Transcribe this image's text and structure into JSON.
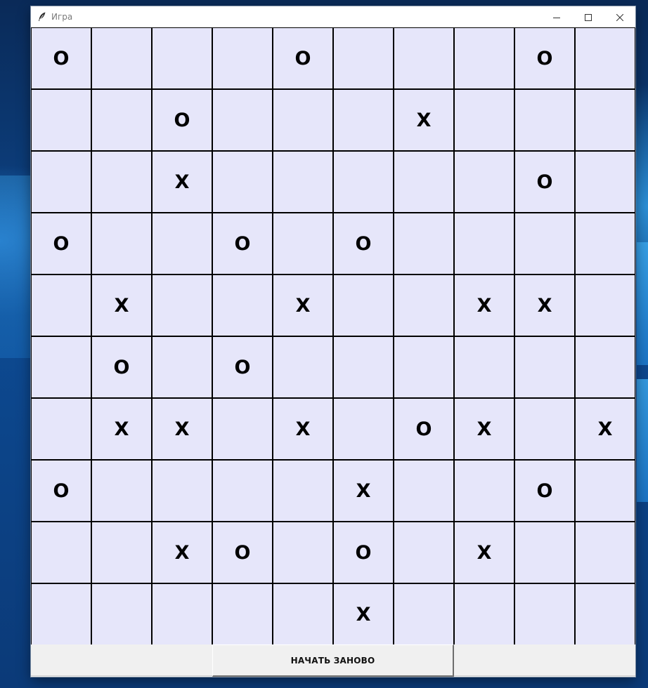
{
  "window": {
    "title": "Игра",
    "controls": [
      "minimize-icon",
      "maximize-icon",
      "close-icon"
    ]
  },
  "colors": {
    "cell_bg": "#e6e6fa",
    "grid_line": "#000000",
    "button_bg": "#f0f0f0"
  },
  "board": {
    "rows": 10,
    "cols": 10,
    "cells": [
      [
        "O",
        "",
        "",
        "",
        "O",
        "",
        "",
        "",
        "O",
        ""
      ],
      [
        "",
        "",
        "O",
        "",
        "",
        "",
        "X",
        "",
        "",
        ""
      ],
      [
        "",
        "",
        "X",
        "",
        "",
        "",
        "",
        "",
        "O",
        ""
      ],
      [
        "O",
        "",
        "",
        "O",
        "",
        "O",
        "",
        "",
        "",
        ""
      ],
      [
        "",
        "X",
        "",
        "",
        "X",
        "",
        "",
        "X",
        "X",
        ""
      ],
      [
        "",
        "O",
        "",
        "O",
        "",
        "",
        "",
        "",
        "",
        ""
      ],
      [
        "",
        "X",
        "X",
        "",
        "X",
        "",
        "O",
        "X",
        "",
        "X"
      ],
      [
        "O",
        "",
        "",
        "",
        "",
        "X",
        "",
        "",
        "O",
        ""
      ],
      [
        "",
        "",
        "X",
        "O",
        "",
        "O",
        "",
        "X",
        "",
        ""
      ],
      [
        "",
        "",
        "",
        "",
        "",
        "X",
        "",
        "",
        "",
        ""
      ]
    ]
  },
  "restart_button": {
    "label": "НАЧАТЬ ЗАНОВО"
  }
}
